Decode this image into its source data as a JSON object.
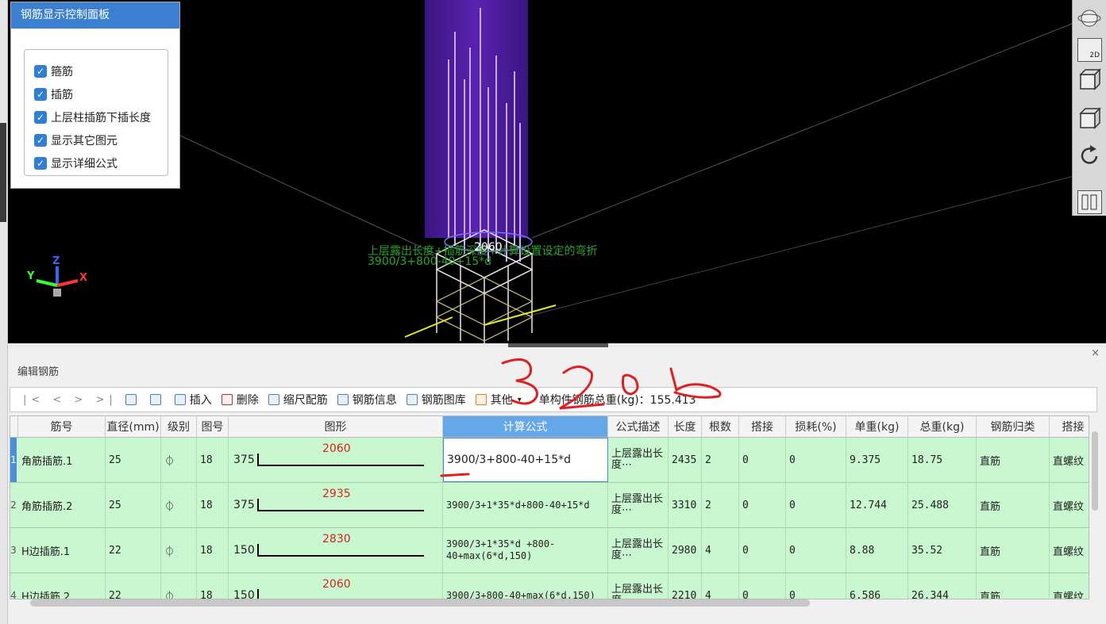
{
  "panel": {
    "title": "钢筋显示控制面板",
    "options": [
      {
        "label": "箍筋",
        "checked": true
      },
      {
        "label": "插筋",
        "checked": true
      },
      {
        "label": "上层柱插筋下插长度",
        "checked": true
      },
      {
        "label": "显示其它图元",
        "checked": true
      },
      {
        "label": "显示详细公式",
        "checked": true
      }
    ]
  },
  "viewport": {
    "label_2060": "2060",
    "annot_line1": "上层露出长度+插筋深度+计算设置设定的弯折",
    "annot_line2": "3900/3+800-40+15*d",
    "axes": {
      "x": "X",
      "y": "Y",
      "z": "Z"
    },
    "view_2d": "2D"
  },
  "editor": {
    "title": "编辑钢筋",
    "close": "×",
    "nav": "|<  <  >  >|",
    "toolbar": {
      "insert": "插入",
      "delete": "删除",
      "scale": "缩尺配筋",
      "info": "钢筋信息",
      "library": "钢筋图库",
      "other": "其他",
      "total_label": "单构件钢筋总重(kg)：155.413"
    },
    "columns": [
      "筋号",
      "直径(mm)",
      "级别",
      "图号",
      "图形",
      "计算公式",
      "公式描述",
      "长度",
      "根数",
      "搭接",
      "损耗(%)",
      "单重(kg)",
      "总重(kg)",
      "钢筋归类",
      "搭接"
    ],
    "rows": [
      {
        "idx": "1",
        "name": "角筋插筋.1",
        "dia": "25",
        "grade": "⏀",
        "fig": "18",
        "s": "375",
        "l": "2060",
        "formula": "3900/3+800-40+15*d",
        "desc": "上层露出长度⋯",
        "len": "2435",
        "count": "2",
        "lap": "0",
        "loss": "0",
        "unit": "9.375",
        "total": "18.75",
        "cls": "直筋",
        "laptype": "直螺纹"
      },
      {
        "idx": "2",
        "name": "角筋插筋.2",
        "dia": "25",
        "grade": "⏀",
        "fig": "18",
        "s": "375",
        "l": "2935",
        "formula": "3900/3+1*35*d+800-40+15*d",
        "desc": "上层露出长度⋯",
        "len": "3310",
        "count": "2",
        "lap": "0",
        "loss": "0",
        "unit": "12.744",
        "total": "25.488",
        "cls": "直筋",
        "laptype": "直螺纹"
      },
      {
        "idx": "3",
        "name": "H边插筋.1",
        "dia": "22",
        "grade": "⏀",
        "fig": "18",
        "s": "150",
        "l": "2830",
        "formula": "3900/3+1*35*d +800-40+max(6*d,150)",
        "desc": "上层露出长度⋯",
        "len": "2980",
        "count": "4",
        "lap": "0",
        "loss": "0",
        "unit": "8.88",
        "total": "35.52",
        "cls": "直筋",
        "laptype": "直螺纹"
      },
      {
        "idx": "4",
        "name": "H边插筋.2",
        "dia": "22",
        "grade": "⏀",
        "fig": "18",
        "s": "150",
        "l": "2060",
        "formula": "3900/3+800-40+max(6*d,150)",
        "desc": "上层露出长度⋯",
        "len": "2210",
        "count": "4",
        "lap": "0",
        "loss": "0",
        "unit": "6.586",
        "total": "26.344",
        "cls": "直筋",
        "laptype": "直螺纹"
      }
    ]
  },
  "annotation_handwritten": "3200",
  "colors": {
    "accent": "#3b7fd0",
    "row_bg": "#c9f7cf",
    "header_sel": "#64a8ea",
    "annot_red": "#e02020",
    "annot_green": "#2aa52a"
  }
}
